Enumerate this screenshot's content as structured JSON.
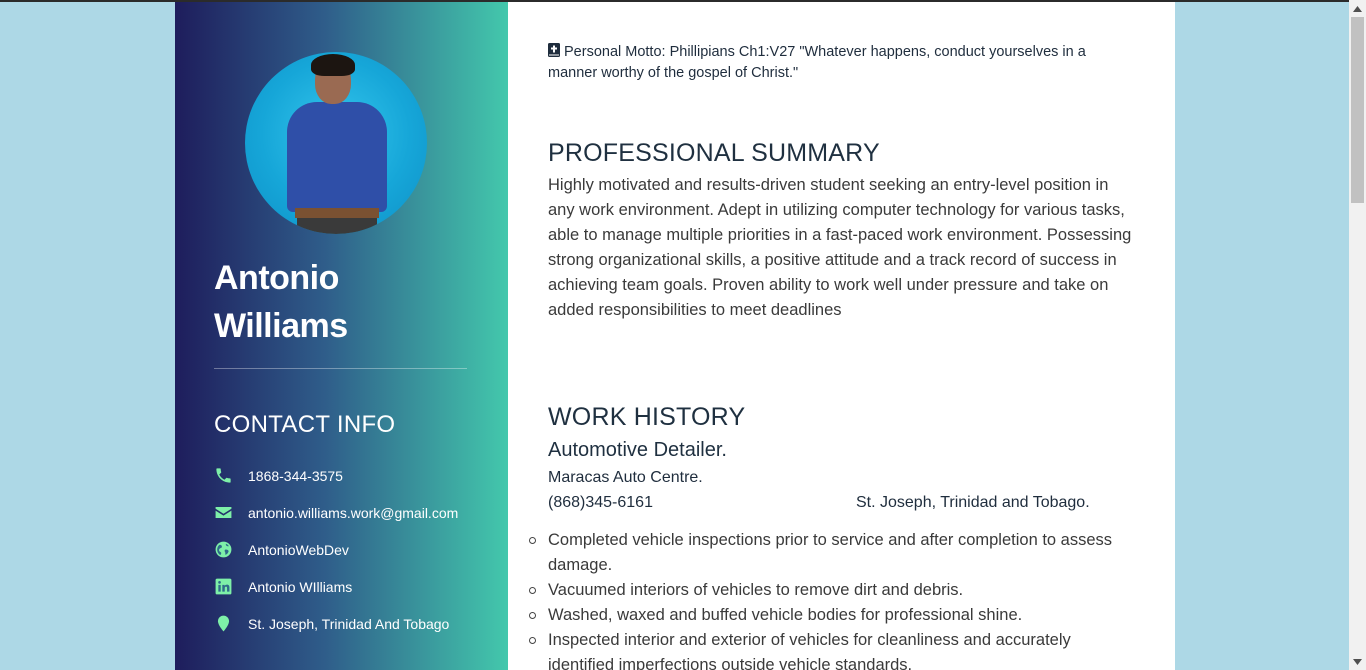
{
  "sidebar": {
    "name_first": "Antonio",
    "name_last": "Williams",
    "contact_title": "CONTACT INFO",
    "contacts": [
      {
        "icon": "phone-icon",
        "text": "1868-344-3575"
      },
      {
        "icon": "envelope-icon",
        "text": "antonio.williams.work@gmail.com"
      },
      {
        "icon": "globe-icon",
        "text": "AntonioWebDev"
      },
      {
        "icon": "linkedin-icon",
        "text": "Antonio WIlliams"
      },
      {
        "icon": "map-marker-icon",
        "text": "St. Joseph, Trinidad And Tobago"
      }
    ],
    "accent_icon_color": "#7ef0a8",
    "gradient": [
      "#1e1d5c",
      "#43c8ac"
    ]
  },
  "main": {
    "motto": "Personal Motto: Phillipians Ch1:V27 \"Whatever happens, conduct yourselves in a manner worthy of the gospel of Christ.\"",
    "summary_title": "PROFESSIONAL SUMMARY",
    "summary_text": "Highly motivated and results-driven student seeking an entry-level position in any work environment. Adept in utilizing computer technology for various tasks, able to manage multiple priorities in a fast-paced work environment. Possessing strong organizational skills, a positive attitude and a track record of success in achieving team goals. Proven ability to work well under pressure and take on added responsibilities to meet deadlines",
    "work_title": "WORK HISTORY",
    "job": {
      "title": "Automotive Detailer.",
      "employer": "Maracas Auto Centre.",
      "phone": "(868)345-6161",
      "location": "St. Joseph, Trinidad and Tobago.",
      "duties": [
        "Completed vehicle inspections prior to service and after completion to assess damage.",
        "Vacuumed interiors of vehicles to remove dirt and debris.",
        "Washed, waxed and buffed vehicle bodies for professional shine.",
        "Inspected interior and exterior of vehicles for cleanliness and accurately identified imperfections outside vehicle standards."
      ]
    }
  },
  "colors": {
    "page_background": "#add8e6",
    "heading": "#1f3040"
  }
}
